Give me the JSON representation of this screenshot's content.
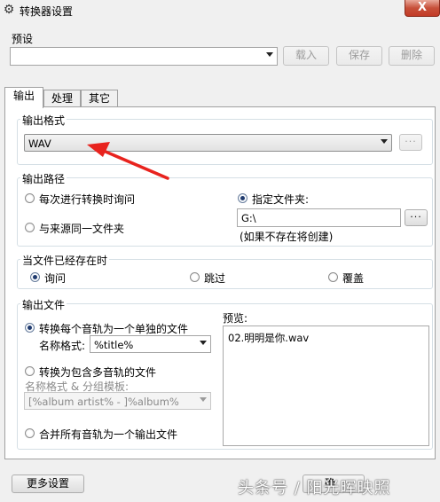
{
  "window": {
    "title": "转换器设置",
    "close_label": "X"
  },
  "preset": {
    "label": "预设",
    "value": "",
    "load_label": "载入",
    "save_label": "保存",
    "delete_label": "删除"
  },
  "tabs": [
    {
      "label": "输出",
      "active": true
    },
    {
      "label": "处理",
      "active": false
    },
    {
      "label": "其它",
      "active": false
    }
  ],
  "output_format": {
    "group_label": "输出格式",
    "value": "WAV",
    "more_label": "..."
  },
  "output_path": {
    "group_label": "输出路径",
    "ask_each_time": "每次进行转换时询问",
    "same_as_source": "与来源同一文件夹",
    "specified_folder": "指定文件夹:",
    "folder_value": "G:\\",
    "browse_label": "...",
    "note": "(如果不存在将创建)",
    "selected": "specified_folder"
  },
  "file_exists": {
    "group_label": "当文件已经存在时",
    "ask": "询问",
    "skip": "跳过",
    "overwrite": "覆盖",
    "selected": "ask"
  },
  "output_file": {
    "group_label": "输出文件",
    "single_file_each": "转换每个音轨为一个单独的文件",
    "name_format_label": "名称格式:",
    "name_format_value": "%title%",
    "multi_track_file": "转换为包含多音轨的文件",
    "name_group_label": "名称格式 & 分组模板:",
    "name_group_value": "[%album artist% - ]%album%",
    "merge_all": "合并所有音轨为一个输出文件",
    "selected": "single_file_each",
    "preview_label": "预览:",
    "preview_value": "02.明明是你.wav"
  },
  "footer": {
    "more_settings": "更多设置",
    "confirm_partial": "确"
  },
  "watermark": "头条号 / 阳光晖映照",
  "colors": {
    "arrow": "#e8231e",
    "close": "#c7503a"
  }
}
